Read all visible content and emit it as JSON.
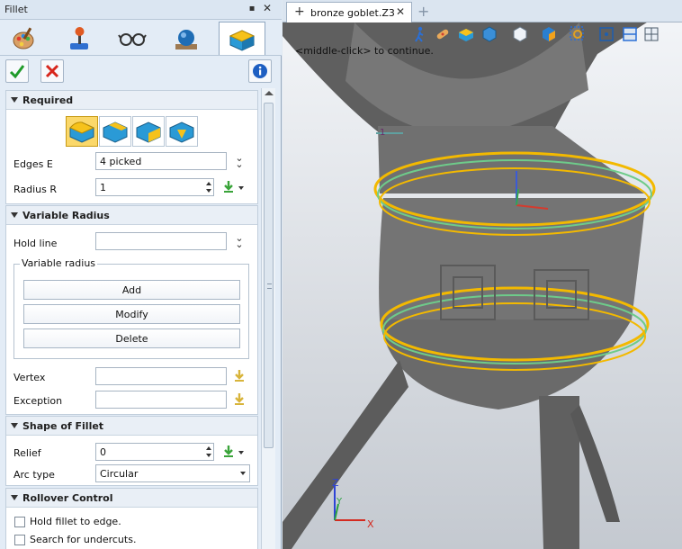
{
  "panel": {
    "title": "Fillet",
    "pin_glyph": "▪",
    "close_glyph": "✕",
    "modes": [
      {
        "name": "paint-palette-icon"
      },
      {
        "name": "joystick-icon"
      },
      {
        "name": "glasses-icon"
      },
      {
        "name": "sphere-icon"
      },
      {
        "name": "fillet-block-icon"
      }
    ],
    "ok_icon": "check-icon",
    "cancel_icon": "cancel-icon",
    "info_icon": "info-icon"
  },
  "required": {
    "heading": "Required",
    "edges_label": "Edges E",
    "edges_value": "4 picked",
    "radius_label": "Radius R",
    "radius_value": "1"
  },
  "variable": {
    "heading": "Variable Radius",
    "hold_line_label": "Hold line",
    "hold_line_value": "",
    "group_label": "Variable radius",
    "add_label": "Add",
    "modify_label": "Modify",
    "delete_label": "Delete",
    "vertex_label": "Vertex",
    "vertex_value": "",
    "exception_label": "Exception",
    "exception_value": ""
  },
  "shape": {
    "heading": "Shape of Fillet",
    "relief_label": "Relief",
    "relief_value": "0",
    "arc_label": "Arc type",
    "arc_value": "Circular"
  },
  "rollover": {
    "heading": "Rollover Control",
    "hold_fillet_label": "Hold fillet to edge.",
    "search_undercuts_label": "Search for undercuts."
  },
  "viewport": {
    "tab_name": "bronze goblet.Z3",
    "tab_close": "✕",
    "new_tab": "+",
    "hint": "<middle-click> to continue.",
    "axis_x": "X",
    "axis_y": "Y",
    "axis_z": "Z",
    "marker": "1"
  },
  "colors": {
    "accent": "#f3b900",
    "edge_highlight": "#6ecb8a",
    "model": "#6b6b6b"
  }
}
